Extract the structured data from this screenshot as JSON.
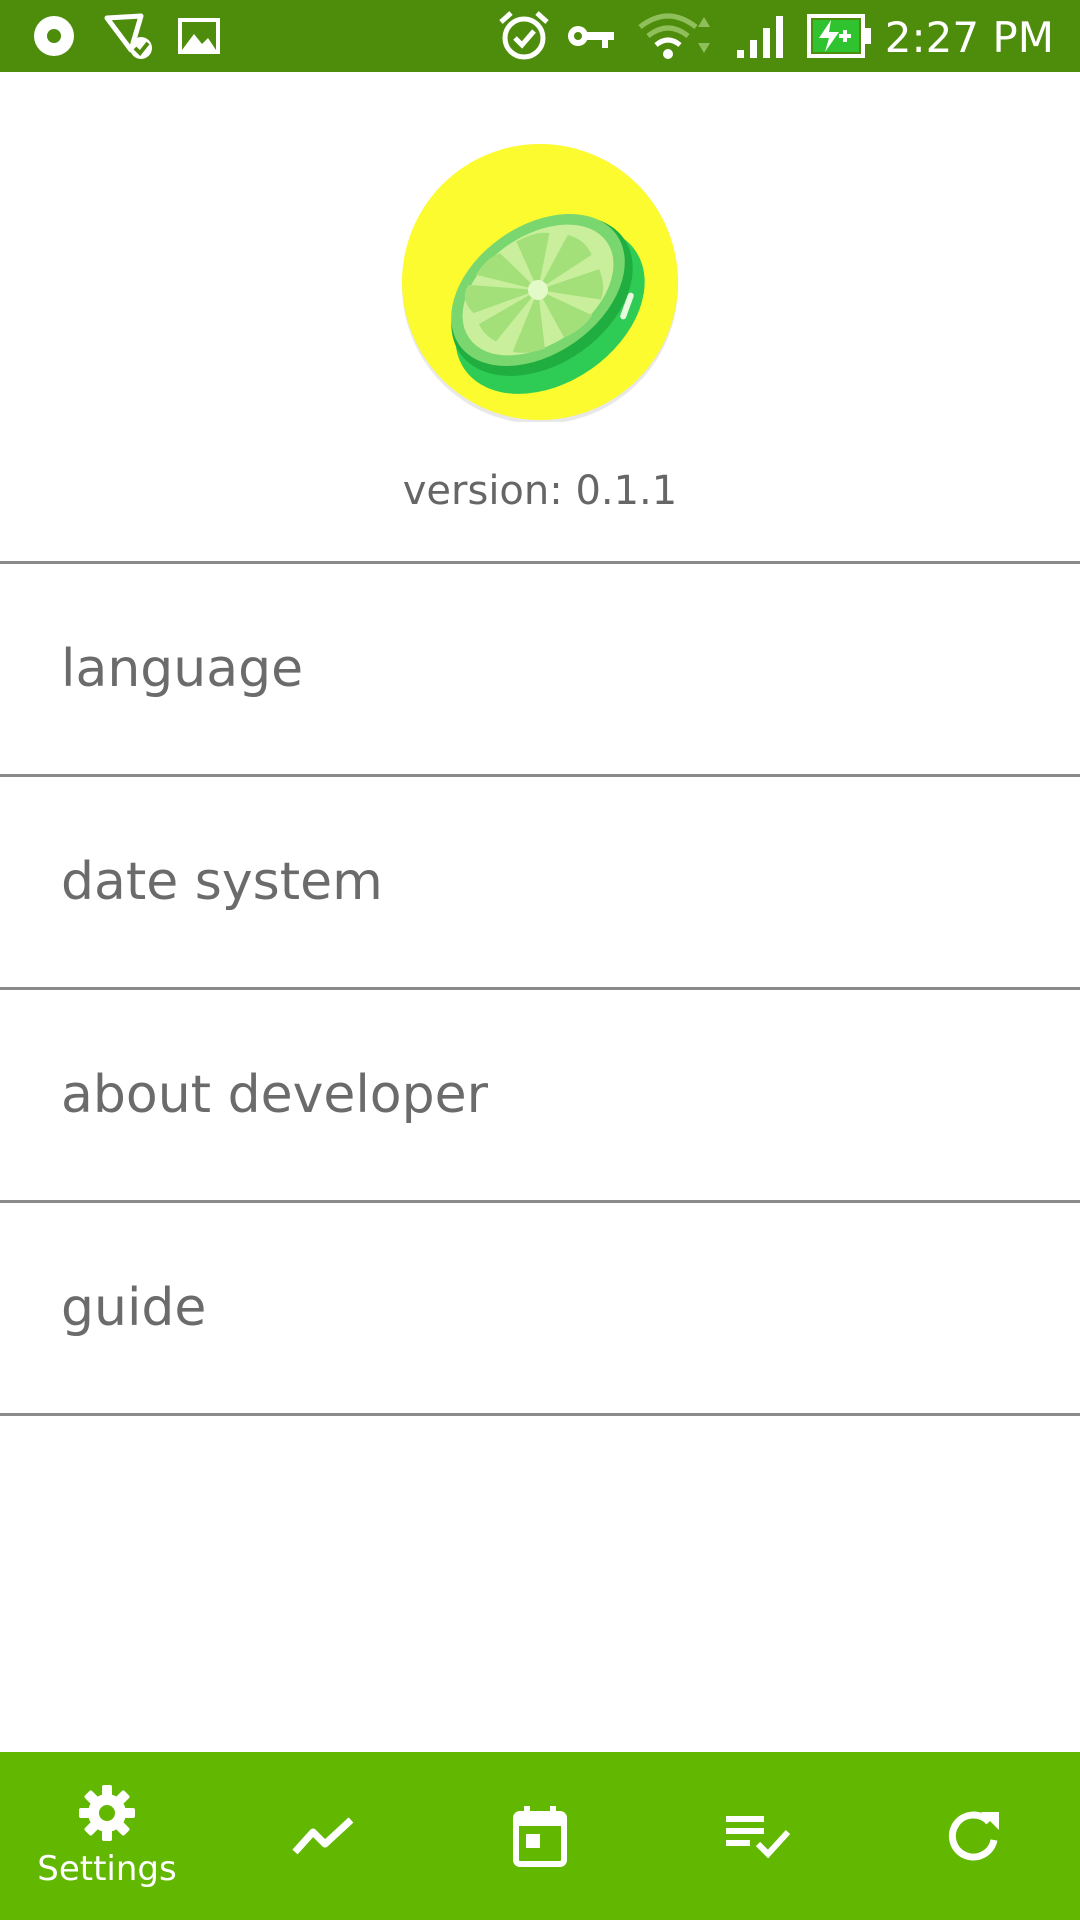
{
  "status_bar": {
    "time": "2:27 PM",
    "icons": [
      "record-icon",
      "location-check-icon",
      "image-icon",
      "alarm-icon",
      "key-icon",
      "wifi-icon",
      "signal-icon",
      "battery-charging-icon"
    ],
    "background": "#4e8d0c"
  },
  "header": {
    "logo": "lime-logo",
    "version": "version: 0.1.1"
  },
  "menu": {
    "items": [
      {
        "label": "language"
      },
      {
        "label": "date system"
      },
      {
        "label": "about developer"
      },
      {
        "label": "guide"
      }
    ]
  },
  "bottom_nav": {
    "background": "#62b700",
    "items": [
      {
        "icon": "gear-icon",
        "label": "Settings",
        "active": true
      },
      {
        "icon": "trend-icon",
        "label": "",
        "active": false
      },
      {
        "icon": "calendar-icon",
        "label": "",
        "active": false
      },
      {
        "icon": "checklist-icon",
        "label": "",
        "active": false
      },
      {
        "icon": "refresh-icon",
        "label": "",
        "active": false
      }
    ]
  }
}
